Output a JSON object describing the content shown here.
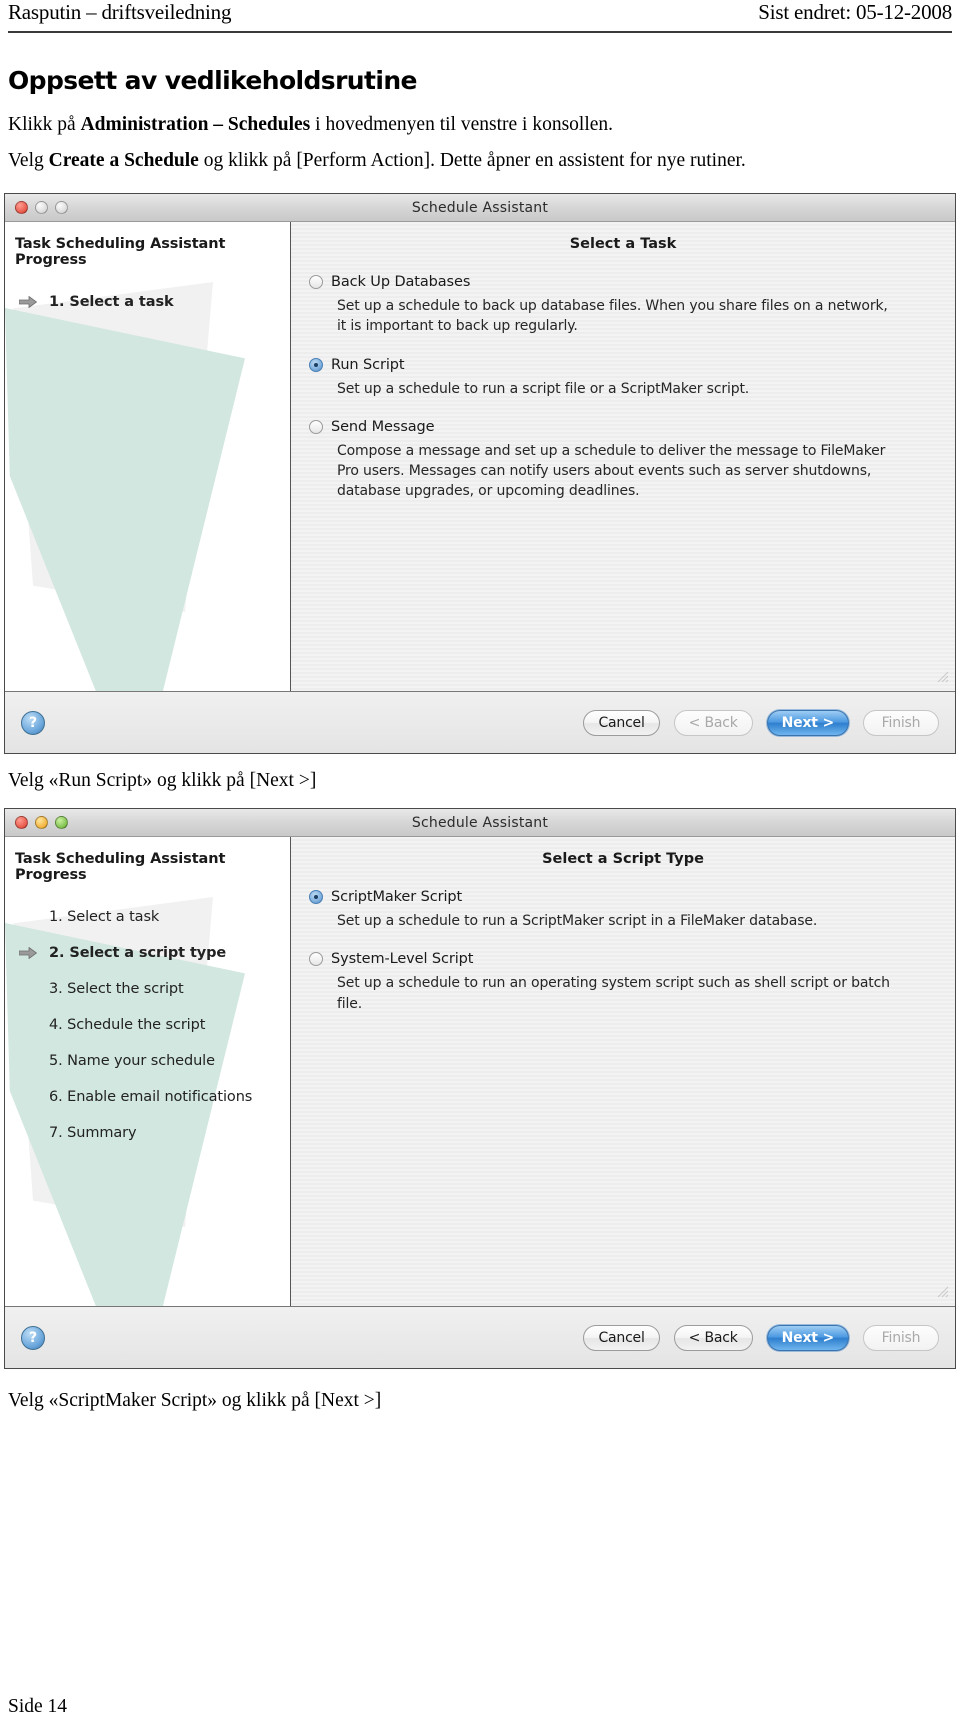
{
  "header": {
    "left": "Rasputin – driftsveiledning",
    "right": "Sist endret: 05-12-2008"
  },
  "doc": {
    "title": "Oppsett av vedlikeholdsrutine",
    "para1": {
      "pre": "Klikk på ",
      "bold": "Administration – Schedules",
      "post": "  i hovedmenyen til venstre i konsollen."
    },
    "para2": {
      "pre": "Velg ",
      "bold": "Create a Schedule",
      "post": " og klikk på [Perform Action]. Dette åpner en assistent for nye rutiner."
    },
    "caption1": "Velg «Run Script» og klikk på [Next >]",
    "caption2": "Velg «ScriptMaker Script» og klikk på [Next >]",
    "footer": "Side 14"
  },
  "window1": {
    "title": "Schedule Assistant",
    "lights": {
      "close": "close-button",
      "minimize": "minimize-button",
      "zoom": "zoom-button"
    },
    "sidebar": {
      "title": "Task Scheduling Assistant Progress",
      "steps": [
        {
          "label": "1. Select a task",
          "active": true
        }
      ]
    },
    "pane": {
      "title": "Select a Task",
      "options": [
        {
          "label": "Back Up Databases",
          "selected": false,
          "desc": "Set up a schedule to back up database files. When you share files on a network, it is important to back up regularly."
        },
        {
          "label": "Run Script",
          "selected": true,
          "desc": "Set up a schedule to run a script file or a ScriptMaker script."
        },
        {
          "label": "Send Message",
          "selected": false,
          "desc": "Compose a message and set up a schedule to deliver the message to FileMaker Pro users. Messages can notify users about events such as server shutdowns, database upgrades, or upcoming deadlines."
        }
      ]
    },
    "footer": {
      "help": "?",
      "cancel": "Cancel",
      "back": "< Back",
      "next": "Next >",
      "finish": "Finish"
    }
  },
  "window2": {
    "title": "Schedule Assistant",
    "sidebar": {
      "title": "Task Scheduling Assistant Progress",
      "steps": [
        {
          "label": "1. Select a task",
          "active": false
        },
        {
          "label": "2. Select a script type",
          "active": true
        },
        {
          "label": "3. Select the script",
          "active": false
        },
        {
          "label": "4. Schedule the script",
          "active": false
        },
        {
          "label": "5. Name your schedule",
          "active": false
        },
        {
          "label": "6. Enable email notifications",
          "active": false
        },
        {
          "label": "7. Summary",
          "active": false
        }
      ]
    },
    "pane": {
      "title": "Select a Script Type",
      "options": [
        {
          "label": "ScriptMaker Script",
          "selected": true,
          "desc": "Set up a schedule to run a ScriptMaker script in a FileMaker database."
        },
        {
          "label": "System-Level Script",
          "selected": false,
          "desc": "Set up a schedule to run an operating system script such as shell script or batch file."
        }
      ]
    },
    "footer": {
      "help": "?",
      "cancel": "Cancel",
      "back": "< Back",
      "next": "Next >",
      "finish": "Finish"
    }
  },
  "colors": {
    "accent_blue": "#2f7fce",
    "ribbon_green": "#cfe6dd",
    "close_red": "#e8594a",
    "min_yellow": "#f2b33c",
    "zoom_green": "#81c24f"
  }
}
